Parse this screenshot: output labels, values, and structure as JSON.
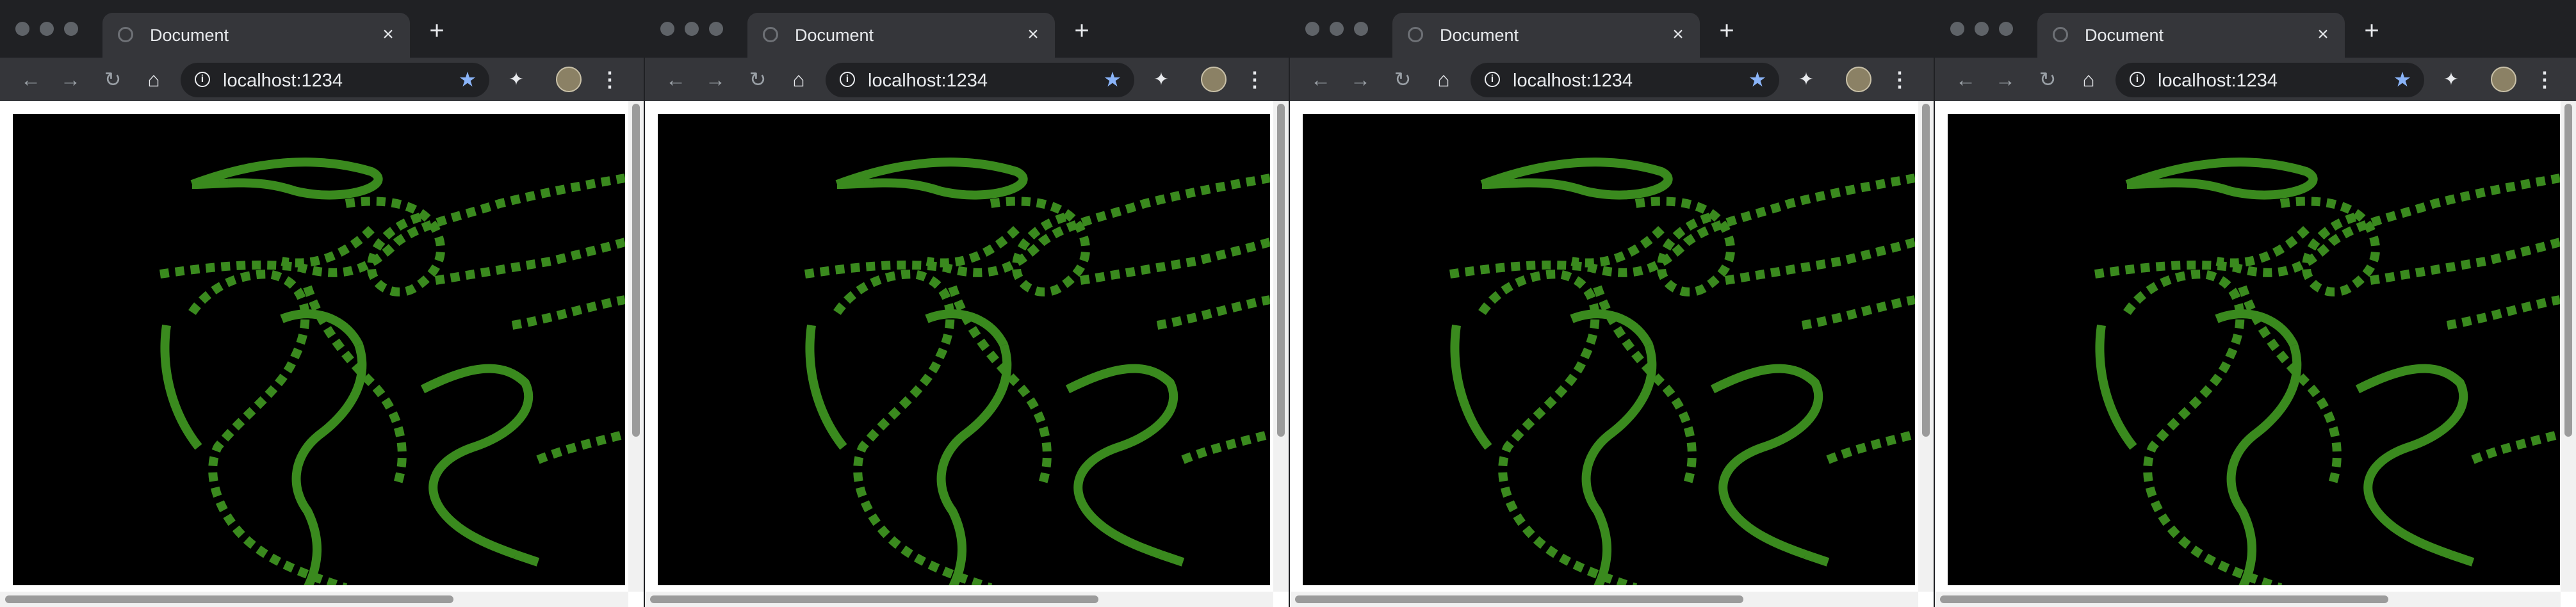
{
  "windows": [
    {
      "tab_title": "Document",
      "url": "localhost:1234"
    },
    {
      "tab_title": "Document",
      "url": "localhost:1234"
    },
    {
      "tab_title": "Document",
      "url": "localhost:1234"
    },
    {
      "tab_title": "Document",
      "url": "localhost:1234"
    }
  ],
  "colors": {
    "frame": "#202124",
    "toolbar": "#35363a",
    "canvas_background": "#000000",
    "drawing_green": "#3a8a1e",
    "star_blue": "#8ab4f8"
  },
  "icons": {
    "back": "arrow-left-icon",
    "forward": "arrow-right-icon",
    "reload": "reload-icon",
    "home": "home-icon",
    "info": "info-icon",
    "bookmark": "star-icon",
    "extension": "pin-icon",
    "profile": "avatar",
    "menu": "kebab-menu-icon",
    "new_tab": "plus-icon",
    "close_tab": "close-icon"
  }
}
